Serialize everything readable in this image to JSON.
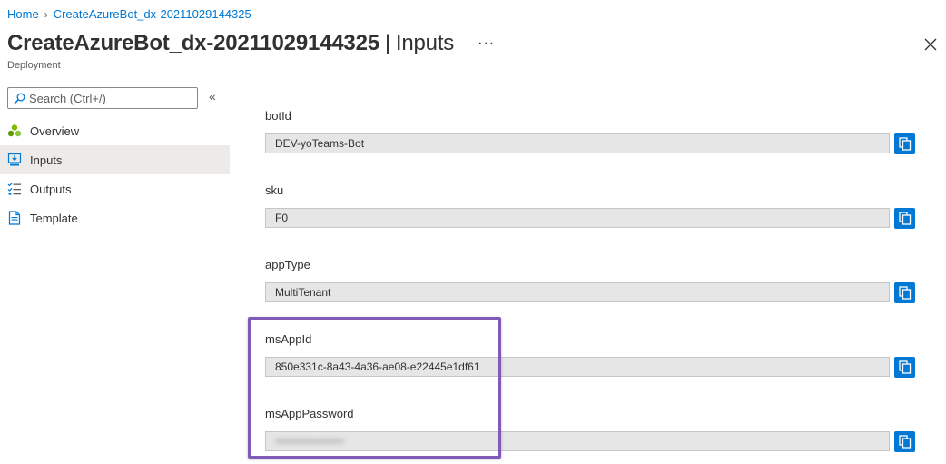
{
  "breadcrumb": {
    "home": "Home",
    "current": "CreateAzureBot_dx-20211029144325"
  },
  "header": {
    "title": "CreateAzureBot_dx-20211029144325",
    "separator": "|",
    "section": "Inputs",
    "more": "···",
    "subtitle": "Deployment"
  },
  "search": {
    "placeholder": "Search (Ctrl+/)",
    "collapse": "«"
  },
  "nav": {
    "items": [
      {
        "label": "Overview",
        "icon": "overview-icon"
      },
      {
        "label": "Inputs",
        "icon": "inputs-icon",
        "active": true
      },
      {
        "label": "Outputs",
        "icon": "outputs-icon"
      },
      {
        "label": "Template",
        "icon": "template-icon"
      }
    ]
  },
  "fields": [
    {
      "label": "botId",
      "value": "DEV-yoTeams-Bot"
    },
    {
      "label": "sku",
      "value": "F0"
    },
    {
      "label": "appType",
      "value": "MultiTenant"
    },
    {
      "label": "msAppId",
      "value": "850e331c-8a43-4a36-ae08-e22445e1df61"
    },
    {
      "label": "msAppPassword",
      "value": "••••••••••••••••••"
    }
  ],
  "colors": {
    "accent": "#0078d4",
    "highlight": "#7f5ab6",
    "nav_active_bg": "#ecebea",
    "field_bg": "#e6e6e6"
  }
}
